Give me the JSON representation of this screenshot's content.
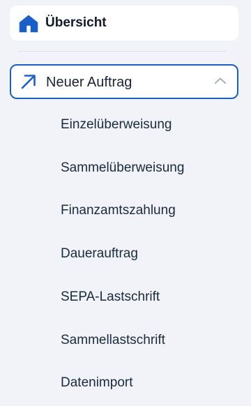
{
  "nav": {
    "overview_label": "Übersicht",
    "new_order": {
      "label": "Neuer Auftrag",
      "expanded": true
    },
    "sub_items": [
      {
        "label": "Einzelüberweisung"
      },
      {
        "label": "Sammelüberweisung"
      },
      {
        "label": "Finanzamtszahlung"
      },
      {
        "label": "Dauerauftrag"
      },
      {
        "label": "SEPA-Lastschrift"
      },
      {
        "label": "Sammellastschrift"
      },
      {
        "label": "Datenimport"
      }
    ]
  },
  "colors": {
    "accent": "#1a5fc7",
    "background": "#f1f3f8",
    "text": "#1a2335",
    "chevron": "#a9b2c0"
  },
  "icons": {
    "overview": "home-icon",
    "new_order": "arrow-up-right-icon",
    "toggle": "chevron-up-icon"
  }
}
